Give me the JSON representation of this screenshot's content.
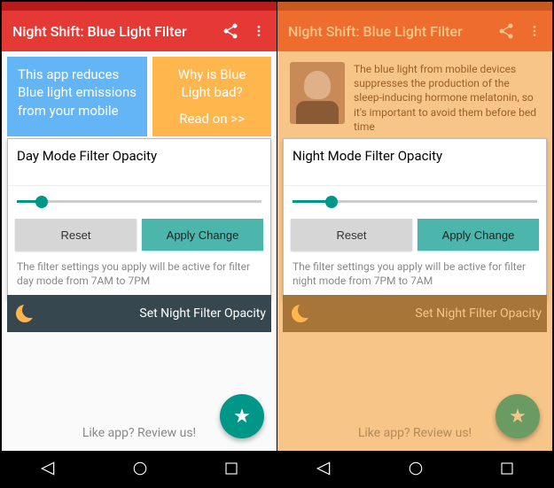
{
  "left": {
    "appbar": {
      "title": "Night Shift: Blue Light Filter"
    },
    "info": {
      "blue": "This app reduces Blue light emissions from your mobile",
      "orange_q": "Why is Blue Light bad?",
      "orange_link": "Read on >>"
    },
    "card": {
      "title": "Day Mode Filter Opacity",
      "reset": "Reset",
      "apply": "Apply Change",
      "help": "The filter settings you apply will be active for filter day mode from 7AM to 7PM",
      "slider_percent": 10
    },
    "nightbar": "Set Night Filter Opacity",
    "review": "Like app? Review us!"
  },
  "right": {
    "appbar": {
      "title": "Night Shift: Blue Light Filter"
    },
    "info": {
      "text": "The blue light from mobile devices suppresses the production of the sleep-inducing hormone melatonin, so it's important to avoid them before bed time"
    },
    "card": {
      "title": "Night Mode Filter Opacity",
      "reset": "Reset",
      "apply": "Apply Change",
      "help": "The filter settings you apply will be active for filter night mode from 7PM to 7AM",
      "slider_percent": 16
    },
    "nightbar": "Set Night Filter Opacity",
    "review": "Like app? Review us!"
  }
}
